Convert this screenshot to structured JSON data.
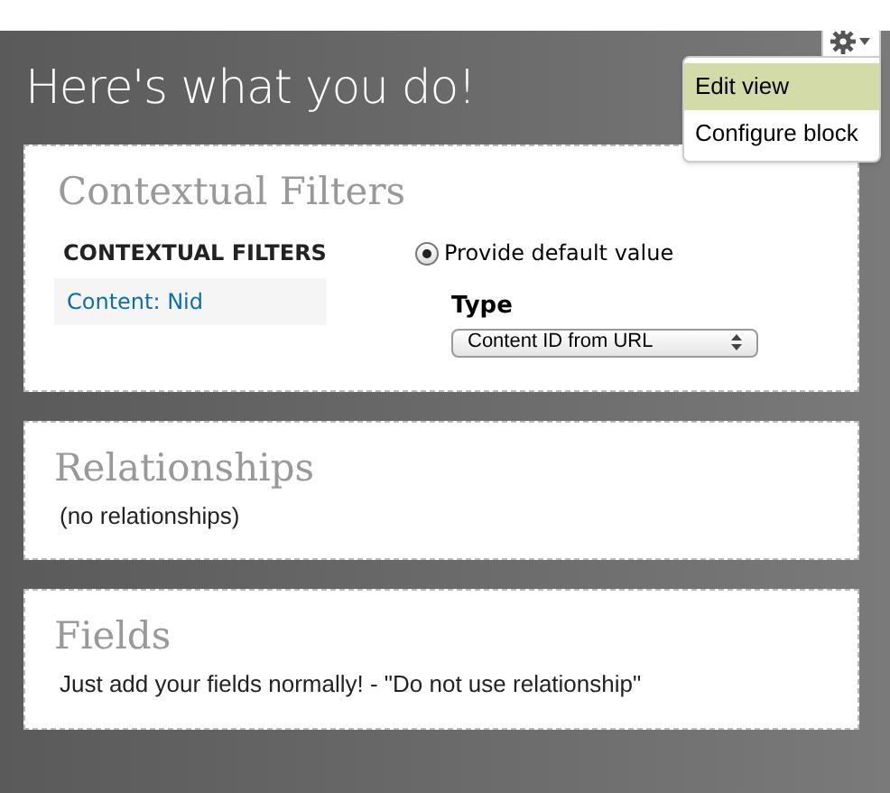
{
  "title": "Here's what you do!",
  "gear_menu": {
    "items": [
      {
        "label": "Edit view",
        "selected": true
      },
      {
        "label": "Configure block",
        "selected": false
      }
    ]
  },
  "panels": [
    {
      "kind": "filters",
      "heading": "Contextual Filters",
      "section_label": "CONTEXTUAL FILTERS",
      "filter_item": "Content: Nid",
      "radio": {
        "label": "Provide default value",
        "checked": true
      },
      "type_label": "Type",
      "type_select": "Content ID from URL"
    },
    {
      "kind": "text",
      "heading": "Relationships",
      "text": "(no relationships)"
    },
    {
      "kind": "text",
      "heading": "Fields",
      "text": "Just add your fields normally! - \"Do not use relationship\""
    }
  ]
}
